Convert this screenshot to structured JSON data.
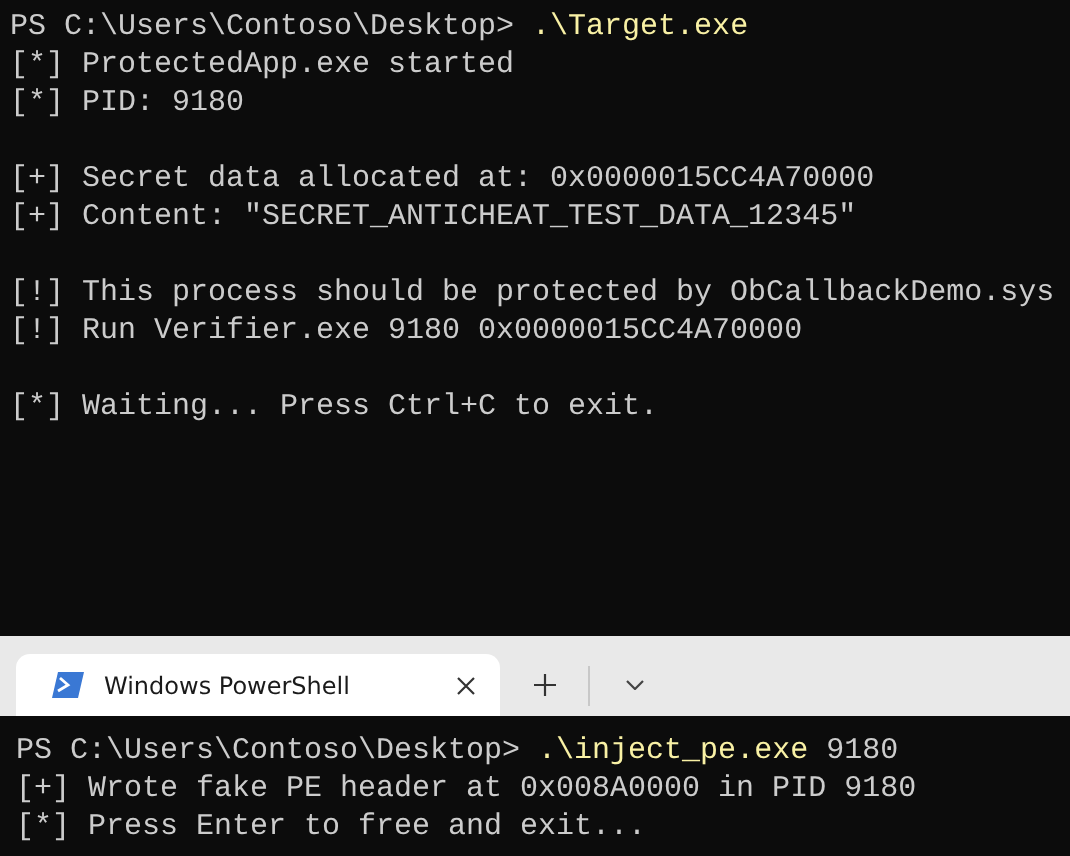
{
  "top_terminal": {
    "blocks": [
      {
        "lines": [
          {
            "segments": [
              {
                "kind": "prompt",
                "text": "PS C:\\Users\\Contoso\\Desktop> "
              },
              {
                "kind": "command",
                "text": ".\\Target.exe"
              }
            ]
          },
          {
            "segments": [
              {
                "kind": "output",
                "text": "[*] ProtectedApp.exe started"
              }
            ]
          },
          {
            "segments": [
              {
                "kind": "output",
                "text": "[*] PID: 9180"
              }
            ]
          }
        ]
      },
      {
        "lines": [
          {
            "segments": [
              {
                "kind": "output",
                "text": "[+] Secret data allocated at: 0x0000015CC4A70000"
              }
            ]
          },
          {
            "segments": [
              {
                "kind": "output",
                "text": "[+] Content: \"SECRET_ANTICHEAT_TEST_DATA_12345\""
              }
            ]
          }
        ]
      },
      {
        "lines": [
          {
            "segments": [
              {
                "kind": "output",
                "text": "[!] This process should be protected by ObCallbackDemo.sys"
              }
            ]
          },
          {
            "segments": [
              {
                "kind": "output",
                "text": "[!] Run Verifier.exe 9180 0x0000015CC4A70000"
              }
            ]
          }
        ]
      },
      {
        "lines": [
          {
            "segments": [
              {
                "kind": "output",
                "text": "[*] Waiting... Press Ctrl+C to exit."
              }
            ]
          }
        ]
      }
    ]
  },
  "tab_bar": {
    "tabs": [
      {
        "title": "Windows PowerShell",
        "selected": true
      }
    ]
  },
  "bottom_terminal": {
    "blocks": [
      {
        "lines": [
          {
            "segments": [
              {
                "kind": "prompt",
                "text": "PS C:\\Users\\Contoso\\Desktop> "
              },
              {
                "kind": "command",
                "text": ".\\inject_pe.exe"
              },
              {
                "kind": "argument",
                "text": " 9180"
              }
            ]
          },
          {
            "segments": [
              {
                "kind": "output",
                "text": "[+] Wrote fake PE header at 0x008A0000 in PID 9180"
              }
            ]
          },
          {
            "segments": [
              {
                "kind": "output",
                "text": "[*] Press Enter to free and exit..."
              }
            ]
          }
        ]
      }
    ]
  }
}
